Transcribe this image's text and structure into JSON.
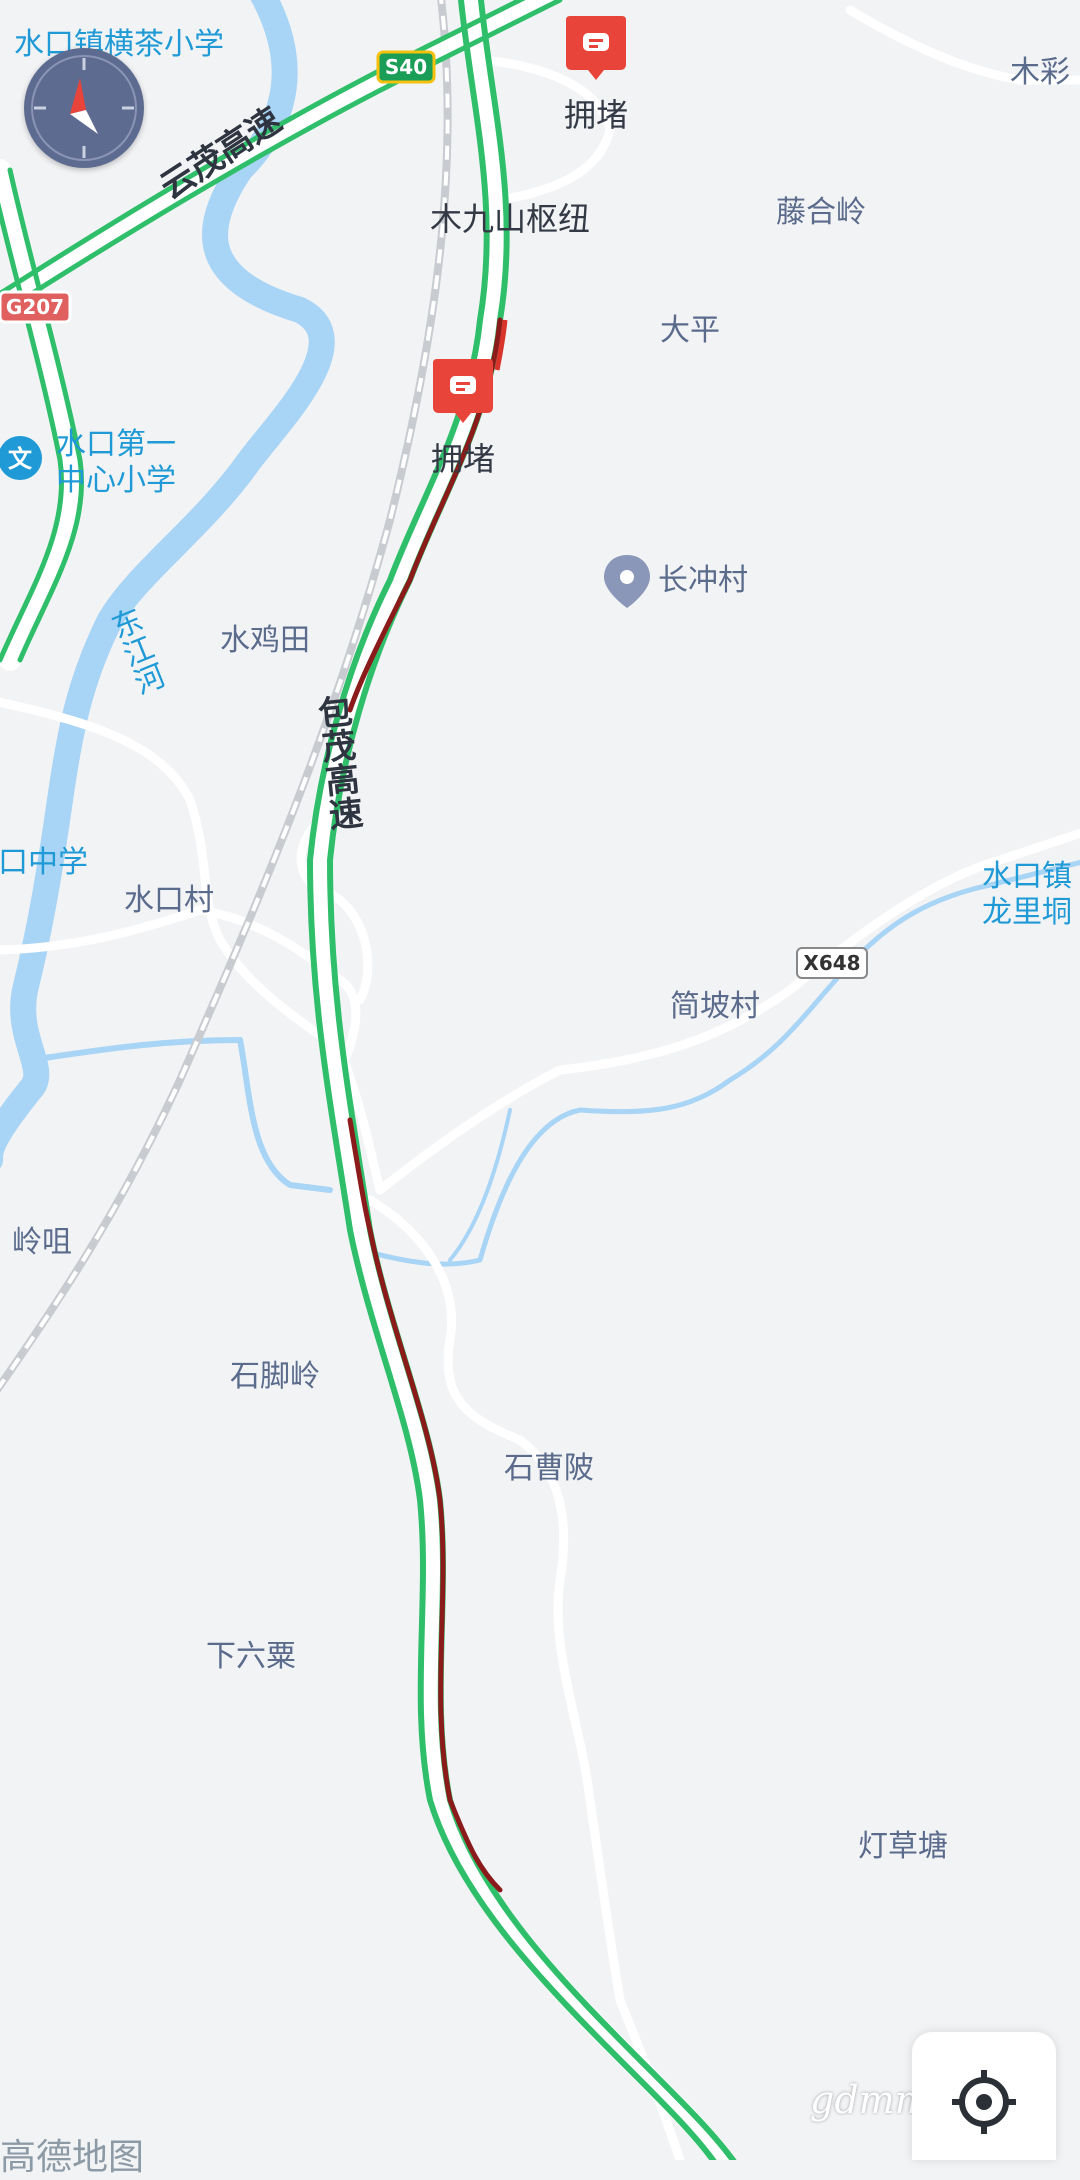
{
  "map": {
    "colors": {
      "background": "#f2f3f5",
      "river": "#a8d4f5",
      "road": "#ffffff",
      "railway": "#c8cbd0",
      "highway_green": "#2fbf6a",
      "highway_jam": "#8b1a1a",
      "highway_slow": "#d9342b",
      "jam_marker": "#e8443a",
      "poi_icon": "#1f9ad6",
      "village_pin": "#8a97b8"
    },
    "pois": [
      {
        "name": "水口镇横茶小学"
      },
      {
        "name": "水口第一",
        "name2": "中心小学",
        "icon": "school-icon"
      },
      {
        "name": "口中学"
      },
      {
        "name": "水口镇",
        "name2": "龙里垌"
      }
    ],
    "places": [
      "木彩",
      "藤合岭",
      "大平",
      "长冲村",
      "水鸡田",
      "水口村",
      "简坡村",
      "岭咀",
      "石脚岭",
      "石曹陂",
      "下六粟",
      "灯草塘"
    ],
    "hub_label": "木九山枢纽",
    "rivers": [
      "东江河"
    ],
    "highways": [
      "云茂高速",
      "包茂高速"
    ],
    "shields": [
      {
        "text": "S40",
        "style": "provincial"
      },
      {
        "text": "G207",
        "style": "national"
      },
      {
        "text": "X648",
        "style": "county"
      }
    ],
    "traffic_events": [
      {
        "label": "拥堵",
        "icon": "congestion-icon"
      },
      {
        "label": "拥堵",
        "icon": "congestion-icon"
      }
    ]
  },
  "controls": {
    "compass_icon": "compass-icon",
    "locate_icon": "crosshair-icon"
  },
  "watermark": "gdmm.com",
  "brand": "高德地图"
}
